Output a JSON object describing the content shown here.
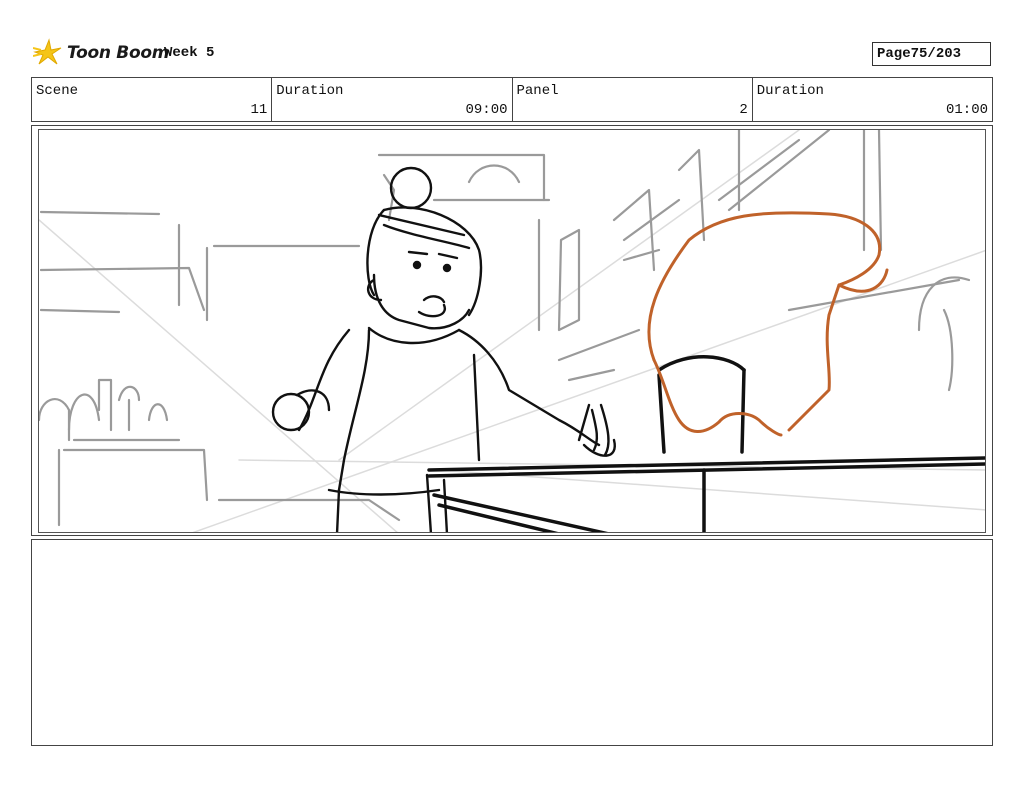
{
  "header": {
    "logo_text": "Toon Boom",
    "title": "Week 5",
    "page_label": "Page",
    "page_value": "75/203"
  },
  "info": [
    {
      "label": "Scene",
      "value": "11"
    },
    {
      "label": "Duration",
      "value": "09:00"
    },
    {
      "label": "Panel",
      "value": "2"
    },
    {
      "label": "Duration",
      "value": "01:00"
    }
  ],
  "colors": {
    "sketch_line": "#111111",
    "rough_line": "#9a9a9a",
    "accent_orange": "#c0622a",
    "logo_yellow": "#f5c518"
  },
  "notes": {
    "text": ""
  }
}
